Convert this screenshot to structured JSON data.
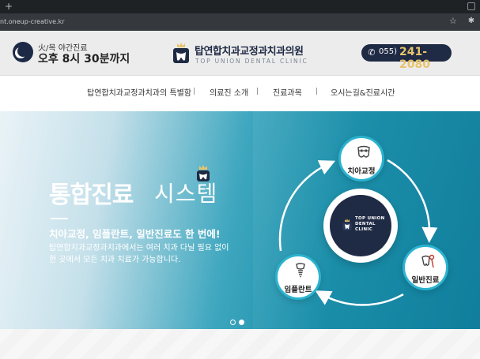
{
  "browser": {
    "new_tab_glyph": "+",
    "url": "nt.oneup-creative.kr",
    "bookmark_icon": "star-icon",
    "extension_icon": "puzzle-icon"
  },
  "header": {
    "night_hours_label": "火/목 야간진료",
    "night_hours_time": "오후 8시 30분까지",
    "logo_title": "탑연합치과교정과치과의원",
    "logo_subtitle": "TOP UNION DENTAL CLINIC",
    "phone_prefix": "055)",
    "phone_number": "241-2080"
  },
  "nav": {
    "items": [
      "탑연합치과교정과치과의 특별함",
      "의료진 소개",
      "진료과목",
      "오시는길&진료시간"
    ]
  },
  "hero": {
    "title_bold": "통합진료",
    "title_light": "시스템",
    "subtitle": "치아교정, 임플란트, 일반진료도 한 번에!",
    "desc_line1": "탑연합치과교정과치과에서는 여러 치과 다닐 필요 없이",
    "desc_line2": "한 곳에서 모든 치과 치료가 가능합니다.",
    "center_text": [
      "TOP UNION",
      "DENTAL",
      "CLINIC"
    ],
    "nodes": {
      "ortho": "치아교정",
      "implant": "임플란트",
      "general": "일반진료"
    },
    "slider": {
      "total": 2,
      "active": 2
    }
  },
  "colors": {
    "navy": "#1f2a44",
    "accent_gold": "#e8c36a",
    "teal": "#138aa6",
    "node_ring": "#2bb3cf"
  }
}
